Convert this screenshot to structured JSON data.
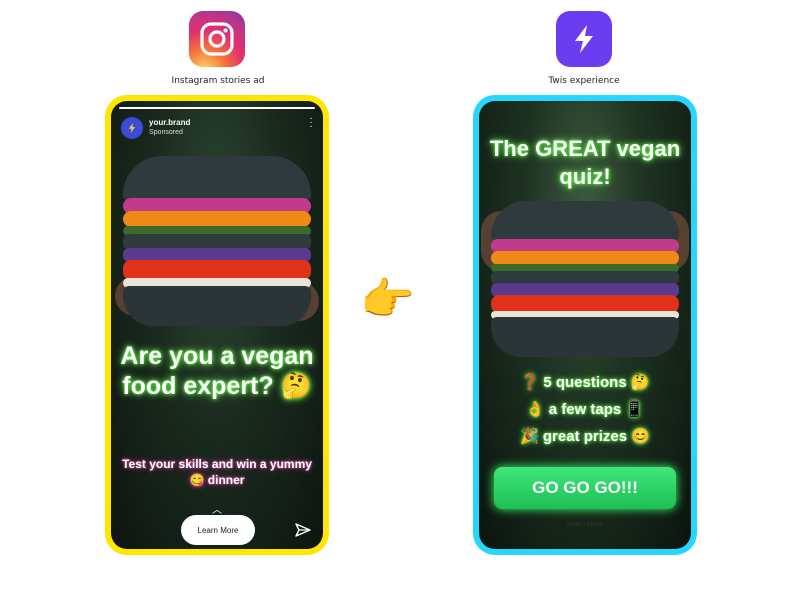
{
  "left_panel": {
    "icon": "instagram-icon",
    "caption": "Instagram stories ad",
    "frame_color": "#ffe600",
    "story": {
      "brand_name": "your.brand",
      "sponsored": "Sponsored",
      "headline": "Are you a vegan food expert? 🤔",
      "subtext": "Test your skills and win a yummy 😋 dinner",
      "cta": "Learn More",
      "icons": [
        "more-dots-icon",
        "chevron-up-icon",
        "send-icon"
      ]
    }
  },
  "pointer": {
    "icon": "pointing-hand-icon",
    "glyph": "👉"
  },
  "right_panel": {
    "icon": "twis-bolt-icon",
    "caption": "Twis experience",
    "frame_color": "#27d6ff",
    "story": {
      "title": "The GREAT vegan quiz!",
      "bullets": [
        "❓ 5 questions 🤔",
        "👌 a few taps 📱",
        "🎉 great prizes 😊"
      ],
      "cta": "GO GO GO!!!",
      "faint_link": "Learn More"
    }
  }
}
